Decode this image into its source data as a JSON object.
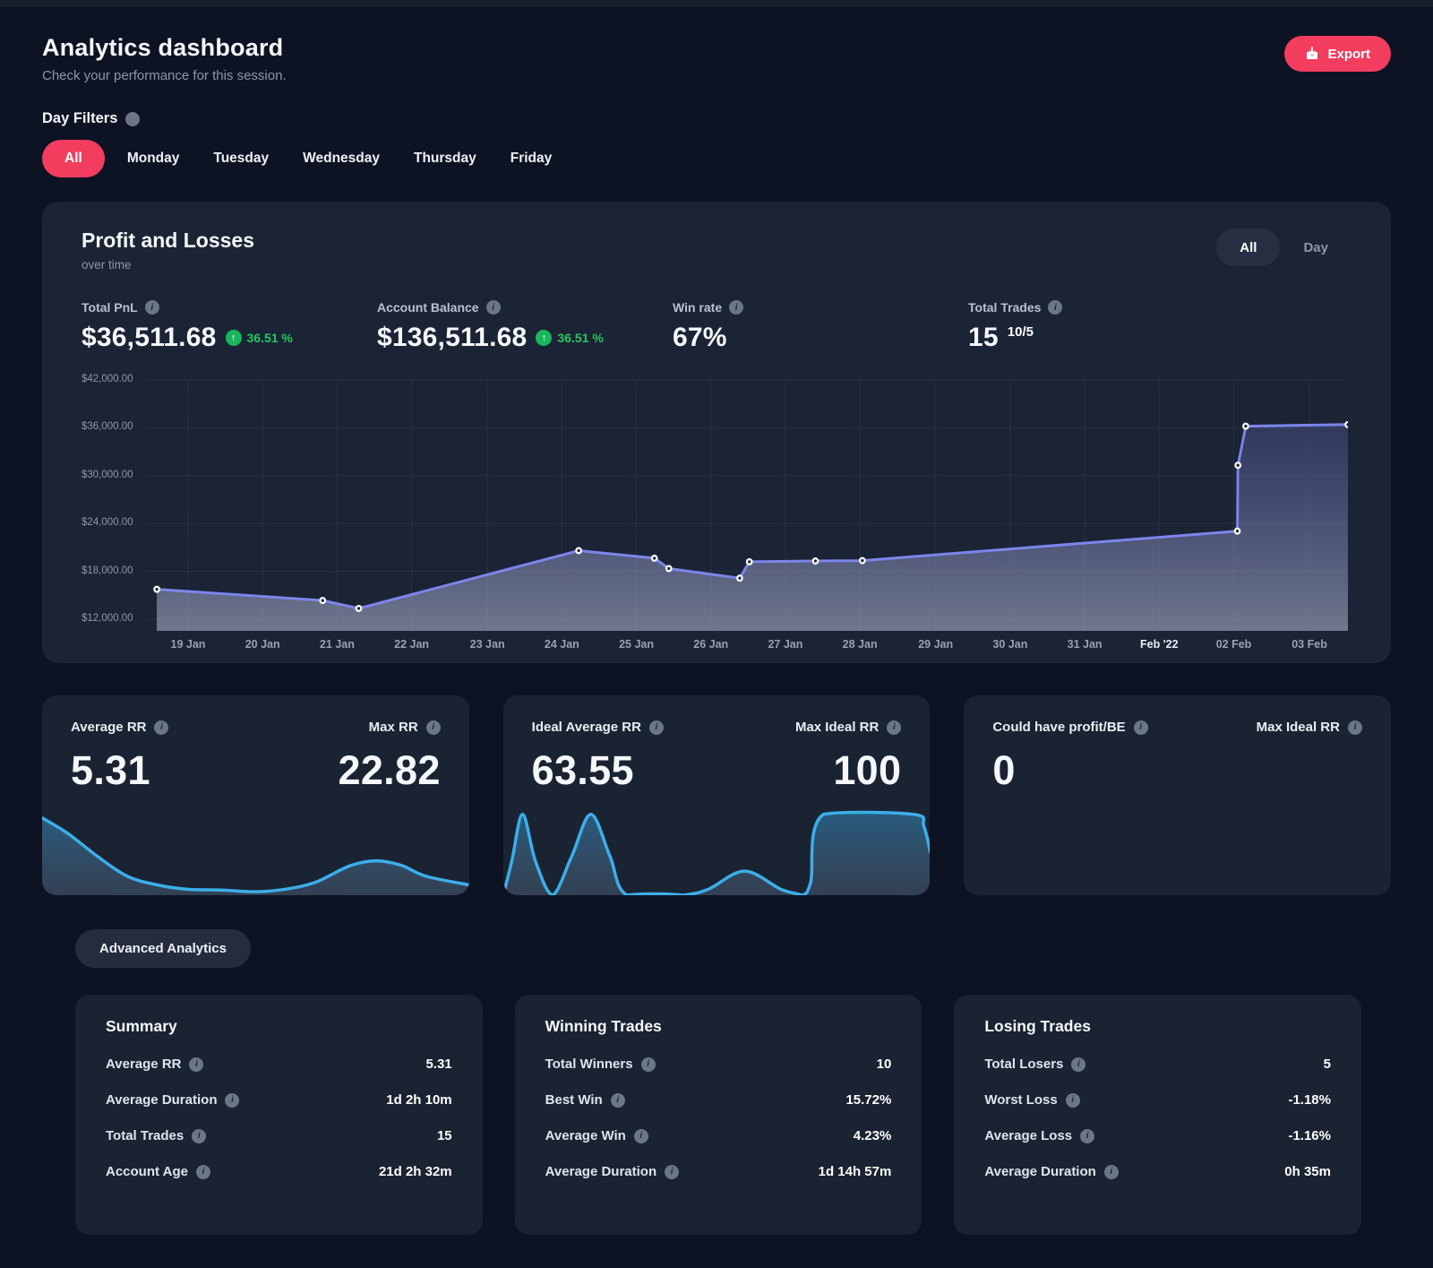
{
  "theme": {
    "page_bg": "#0d1322",
    "card_bg": "#1b2434",
    "accent_pink": "#f33d5f",
    "positive_green": "#25c55f",
    "line_purple": "#7c85ea",
    "spark_blue": "#3caee9"
  },
  "icons": {
    "info": "i",
    "up_arrow": "↑"
  },
  "header": {
    "title": "Analytics dashboard",
    "subtitle": "Check your performance for this session.",
    "export_label": "Export"
  },
  "filters": {
    "label": "Day Filters",
    "items": [
      {
        "label": "All",
        "active": true
      },
      {
        "label": "Monday",
        "active": false
      },
      {
        "label": "Tuesday",
        "active": false
      },
      {
        "label": "Wednesday",
        "active": false
      },
      {
        "label": "Thursday",
        "active": false
      },
      {
        "label": "Friday",
        "active": false
      }
    ]
  },
  "pnl_card": {
    "title": "Profit and Losses",
    "subtitle": "over time",
    "toggle": {
      "options": [
        "All",
        "Day"
      ],
      "selected": "All"
    },
    "stats": [
      {
        "label": "Total PnL",
        "value": "$36,511.68",
        "change": "36.51 %"
      },
      {
        "label": "Account Balance",
        "value": "$136,511.68",
        "change": "36.51 %"
      },
      {
        "label": "Win rate",
        "value": "67%"
      },
      {
        "label": "Total Trades",
        "value": "15",
        "sup": "10/5"
      }
    ]
  },
  "chart_data": [
    {
      "type": "area",
      "name": "pnl-over-time",
      "title": "Profit and Losses over time",
      "ylim": [
        12000,
        42000
      ],
      "grid": true,
      "legend": "none",
      "y_ticks": [
        "$42,000.00",
        "$36,000.00",
        "$30,000.00",
        "$24,000.00",
        "$18,000.00",
        "$12,000.00"
      ],
      "x_ticks": [
        "19 Jan",
        "20 Jan",
        "21 Jan",
        "22 Jan",
        "23 Jan",
        "24 Jan",
        "25 Jan",
        "26 Jan",
        "27 Jan",
        "28 Jan",
        "29 Jan",
        "30 Jan",
        "31 Jan",
        "Feb '22",
        "02 Feb",
        "03 Feb"
      ],
      "emphasized_x_tick": "Feb '22",
      "x_tick_fractions": [
        0.035,
        0.097,
        0.159,
        0.221,
        0.284,
        0.346,
        0.408,
        0.47,
        0.532,
        0.594,
        0.657,
        0.719,
        0.781,
        0.843,
        0.905,
        0.968
      ],
      "series": [
        {
          "name": "Account balance ($)",
          "points": [
            [
              0.009,
              15750
            ],
            [
              0.147,
              14350
            ],
            [
              0.177,
              13350
            ],
            [
              0.36,
              20600
            ],
            [
              0.423,
              19650
            ],
            [
              0.435,
              18350
            ],
            [
              0.494,
              17150
            ],
            [
              0.502,
              19200
            ],
            [
              0.557,
              19300
            ],
            [
              0.596,
              19350
            ],
            [
              0.908,
              23050
            ],
            [
              0.9085,
              31300
            ],
            [
              0.915,
              36200
            ],
            [
              1.0,
              36400
            ]
          ]
        }
      ]
    },
    {
      "type": "area",
      "name": "average-rr-sparkline",
      "normalized": true,
      "points": [
        [
          0,
          0.1
        ],
        [
          0.06,
          0.28
        ],
        [
          0.13,
          0.55
        ],
        [
          0.2,
          0.78
        ],
        [
          0.27,
          0.88
        ],
        [
          0.34,
          0.93
        ],
        [
          0.42,
          0.94
        ],
        [
          0.5,
          0.96
        ],
        [
          0.57,
          0.93
        ],
        [
          0.64,
          0.85
        ],
        [
          0.72,
          0.66
        ],
        [
          0.78,
          0.6
        ],
        [
          0.84,
          0.65
        ],
        [
          0.9,
          0.78
        ],
        [
          1,
          0.88
        ]
      ]
    },
    {
      "type": "area",
      "name": "ideal-rr-sparkline",
      "normalized": true,
      "points": [
        [
          0,
          1
        ],
        [
          0.02,
          0.6
        ],
        [
          0.045,
          0.06
        ],
        [
          0.075,
          0.6
        ],
        [
          0.115,
          1
        ],
        [
          0.16,
          0.55
        ],
        [
          0.205,
          0.06
        ],
        [
          0.25,
          0.55
        ],
        [
          0.29,
          1
        ],
        [
          0.42,
          1
        ],
        [
          0.48,
          0.93
        ],
        [
          0.565,
          0.72
        ],
        [
          0.65,
          0.93
        ],
        [
          0.7,
          1
        ],
        [
          0.72,
          0.85
        ],
        [
          0.75,
          0.06
        ],
        [
          0.96,
          0.06
        ],
        [
          0.985,
          0.2
        ],
        [
          1,
          0.5
        ]
      ]
    }
  ],
  "rr_cards": [
    {
      "left_label": "Average RR",
      "left_value": "5.31",
      "right_label": "Max RR",
      "right_value": "22.82",
      "spark": 1
    },
    {
      "left_label": "Ideal Average RR",
      "left_value": "63.55",
      "right_label": "Max Ideal RR",
      "right_value": "100",
      "spark": 2
    },
    {
      "left_label": "Could have profit/BE",
      "left_value": "0",
      "right_label": "Max Ideal RR",
      "right_value": "",
      "spark": null
    }
  ],
  "advanced_button_label": "Advanced Analytics",
  "detail_cards": [
    {
      "title": "Summary",
      "rows": [
        {
          "label": "Average RR",
          "value": "5.31"
        },
        {
          "label": "Average Duration",
          "value": "1d 2h 10m"
        },
        {
          "label": "Total Trades",
          "value": "15"
        },
        {
          "label": "Account Age",
          "value": "21d 2h 32m"
        }
      ]
    },
    {
      "title": "Winning Trades",
      "rows": [
        {
          "label": "Total Winners",
          "value": "10"
        },
        {
          "label": "Best Win",
          "value": "15.72%"
        },
        {
          "label": "Average Win",
          "value": "4.23%"
        },
        {
          "label": "Average Duration",
          "value": "1d 14h 57m"
        }
      ]
    },
    {
      "title": "Losing Trades",
      "rows": [
        {
          "label": "Total Losers",
          "value": "5"
        },
        {
          "label": "Worst Loss",
          "value": "-1.18%"
        },
        {
          "label": "Average Loss",
          "value": "-1.16%"
        },
        {
          "label": "Average Duration",
          "value": "0h 35m"
        }
      ]
    }
  ]
}
